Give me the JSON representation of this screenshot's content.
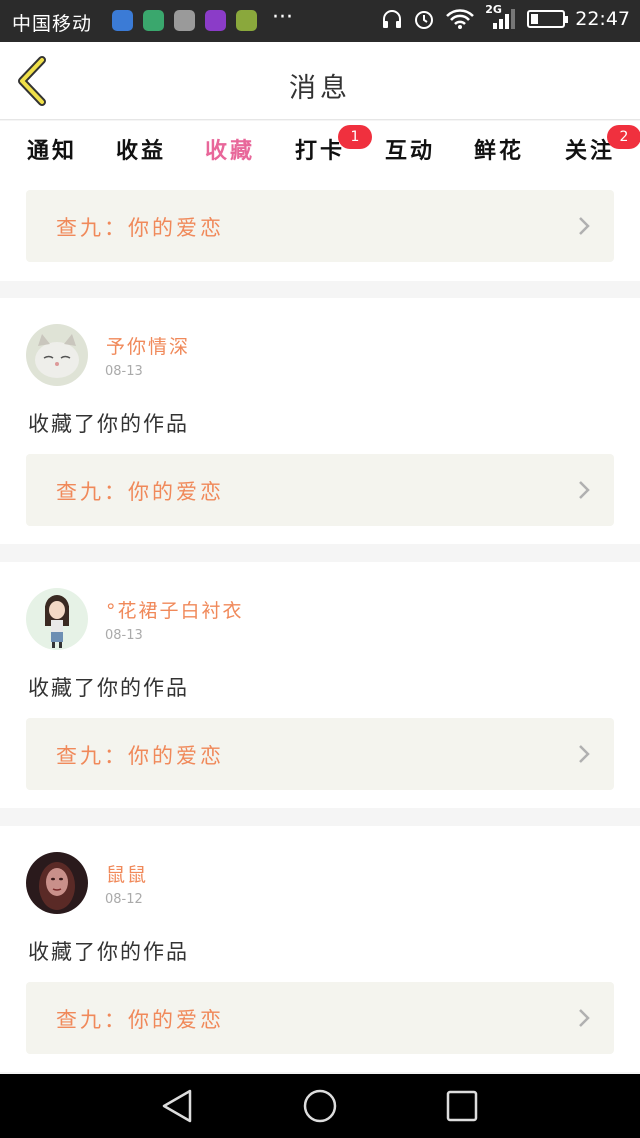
{
  "status_bar": {
    "carrier": "中国移动",
    "more": "···",
    "network": "2G",
    "time": "22:47",
    "app_icon_colors": [
      "#3b7bd6",
      "#3aa76d",
      "#9a9a9a",
      "#8b3cc8",
      "#8aa83c"
    ]
  },
  "header": {
    "title": "消息",
    "back_icon": "chevron-left-icon"
  },
  "tabs": [
    {
      "label": "通知",
      "badge": ""
    },
    {
      "label": "收益",
      "badge": ""
    },
    {
      "label": "收藏",
      "badge": "",
      "active": true
    },
    {
      "label": "打卡",
      "badge": "1"
    },
    {
      "label": "互动",
      "badge": ""
    },
    {
      "label": "鲜花",
      "badge": ""
    },
    {
      "label": "关注",
      "badge": "2"
    }
  ],
  "first_item": {
    "work_title": "查九：你的爱恋"
  },
  "items": [
    {
      "username": "予你情深",
      "date": "08-13",
      "action": "收藏了你的作品",
      "work_title": "查九：你的爱恋"
    },
    {
      "username": "°花裙子白衬衣",
      "date": "08-13",
      "action": "收藏了你的作品",
      "work_title": "查九：你的爱恋"
    },
    {
      "username": "鼠鼠",
      "date": "08-12",
      "action": "收藏了你的作品",
      "work_title": "查九：你的爱恋"
    }
  ],
  "colors": {
    "accent": "#e8679a",
    "username": "#f0895a",
    "badge": "#f0303e"
  }
}
